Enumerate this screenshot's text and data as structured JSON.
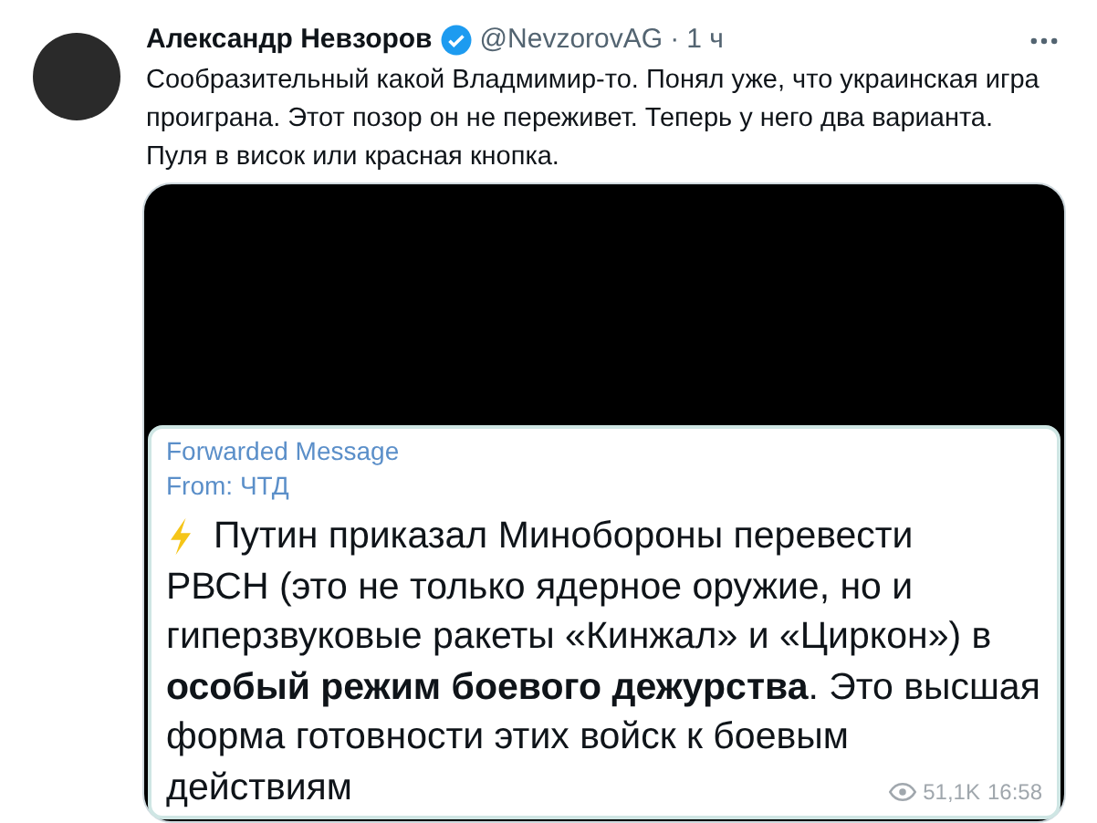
{
  "tweet": {
    "author": "Александр Невзоров",
    "verified": true,
    "handle": "@NevzorovAG",
    "separator": "·",
    "time": "1 ч",
    "text_lines": [
      "Сообразительный какой Владмимир-то. Понял уже, что украинская игра",
      "проиграна.  Этот позор он не переживет. Теперь у него два варианта.",
      "Пуля в висок или красная кнопка."
    ]
  },
  "telegram_message": {
    "forward_label": "Forwarded Message",
    "from": "From: ЧТД",
    "text_lines": [
      "Путин приказал Минобороны перевести",
      "РВСН (это не только ядерное оружие, но и",
      "гиперзвуковые ракеты «Кинжал» и «Циркон») в",
      "**особый режим боевого дежурства**. Это высшая",
      "форма готовности этих войск к боевым",
      "действиям"
    ],
    "views": "51,1K",
    "time": "16:58"
  }
}
